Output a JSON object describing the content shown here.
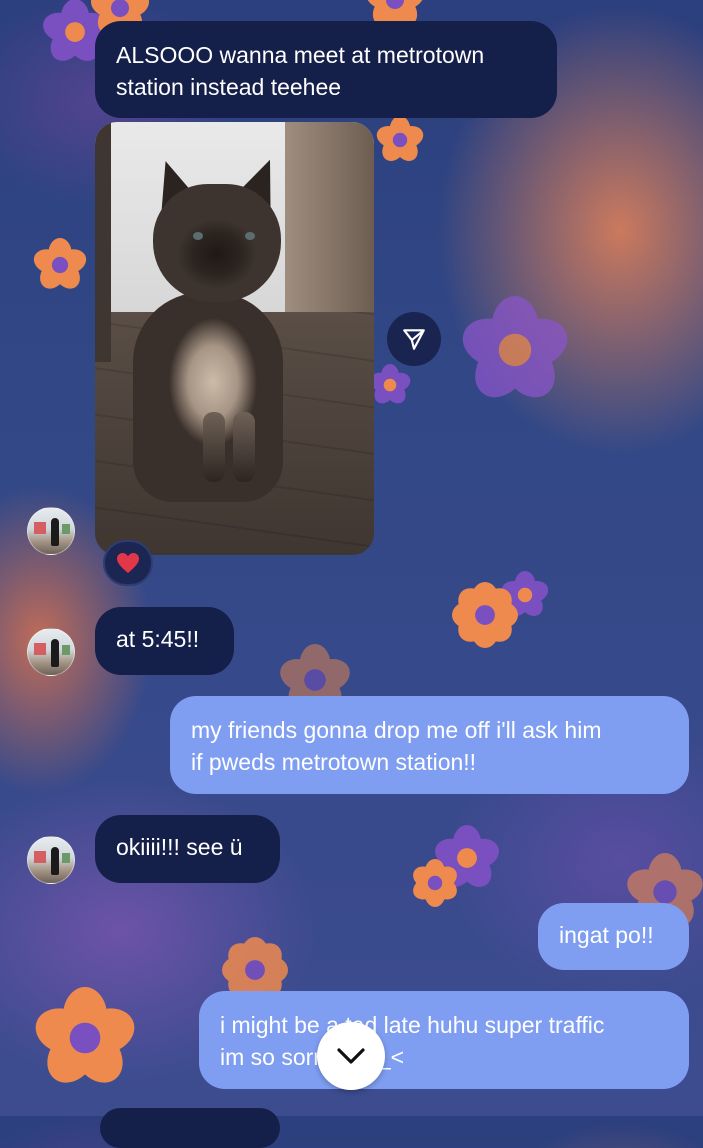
{
  "messages": [
    {
      "sender": "them",
      "text": "ALSOOO wanna meet at metrotown\nstation instead teehee"
    },
    {
      "sender": "them",
      "type": "photo",
      "reaction": "heart"
    },
    {
      "sender": "them",
      "text": "at 5:45!!"
    },
    {
      "sender": "me",
      "text": "my friends gonna drop me off i'll ask him\nif pweds metrotown station!!"
    },
    {
      "sender": "them",
      "text": "okiiii!!! see ü"
    },
    {
      "sender": "me",
      "text": "ingat po!!"
    },
    {
      "sender": "me",
      "text": "i might be a tad late huhu super traffic\nim so sorry >___<"
    }
  ],
  "icons": {
    "share": "send-icon",
    "reaction": "heart-icon",
    "scroll": "chevron-down-icon"
  },
  "colors": {
    "incoming_bubble": "#15204a",
    "outgoing_bubble": "#7f9ef2",
    "reaction_heart": "#e2364b",
    "background": "#324886"
  }
}
